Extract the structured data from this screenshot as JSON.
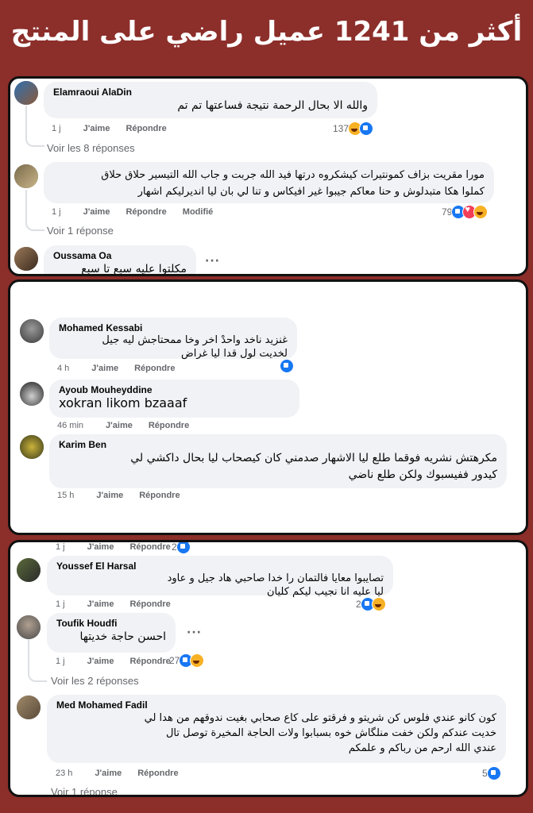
{
  "headline": "أكثر من 1241 عميل راضي على المنتج",
  "colors": {
    "background": "#8c2e2a",
    "bubble": "#f0f2f5",
    "like": "#1877f2"
  },
  "labels": {
    "like": "J'aime",
    "reply": "Répondre",
    "modified": "Modifié"
  },
  "panel1": {
    "c1": {
      "author": "Elamraoui AlaDin",
      "text": "والله الا بحال الرحمة نتيجة فساعتها تم تم",
      "time": "1 j",
      "reactions": "137",
      "replies": "Voir les 8 réponses"
    },
    "c2": {
      "author": "",
      "text": "مورا مقريت بزاف كمونتيرات كيشكروه درتها فيد الله جربت و جاب الله التيسير     حلاق حلاق\nكملوا هكا متبدلوش و حنا معاكم جيبوا غير افيكاس و تنا لي بان ليا انديرليكم اشهار",
      "time": "1 j",
      "reactions": "79",
      "replies": "Voir 1 réponse"
    },
    "c3": {
      "author": "Oussama Oa",
      "text": "مكلتوا عليه سبع تا سبع"
    }
  },
  "panel2": {
    "c1": {
      "author": "Mohamed Kessabi",
      "text": "غنزيد ناخد واحدْ اخر وخا ممحتاجش ليه جيل\nلخديت لول قدا ليا غراض",
      "time": "4 h"
    },
    "c2": {
      "author": "Ayoub Mouheyddine",
      "text": "xokran likom bzaaaf",
      "time": "46 min"
    },
    "c3": {
      "author": "Karim Ben",
      "text": "مكرهتش نشريه فوقما طلع ليا الاشهار صدمني كان كيصحاب ليا بحال داكشي لي\nكيدور ففيسبوك ولكن طلع ناضي",
      "time": "15 h"
    }
  },
  "panel3": {
    "c0": {
      "time": "1 j",
      "reactions": "2"
    },
    "c1": {
      "author": "Youssef El Harsal",
      "text": "تصايبوا معايا فالتمان را خدا صاحبي  هاد جيل و عاود\nليا عليه انا نجيب ليكم كليان",
      "time": "1 j",
      "reactions": "2"
    },
    "c2": {
      "author": "Toufik Houdfi",
      "text": "احسن حاجة خديتها",
      "time": "1 j",
      "reactions": "27",
      "replies": "Voir les 2 réponses"
    },
    "c3": {
      "author": "Med Mohamed Fadil",
      "text": "كون كانو عندي فلوس كن شريتو و فرقتو على كاع صحابي بغيت ندوقهم من هدا لي\nخديت عندكم ولكن خفت منلگاش خوه  بسبابوا ولات الحاجة المخيرة توصل تال\nعندي الله ارحم من رباكم و علمكم",
      "time": "23 h",
      "reactions": "5"
    },
    "c4": {
      "replies": "Voir 1 réponse"
    }
  }
}
